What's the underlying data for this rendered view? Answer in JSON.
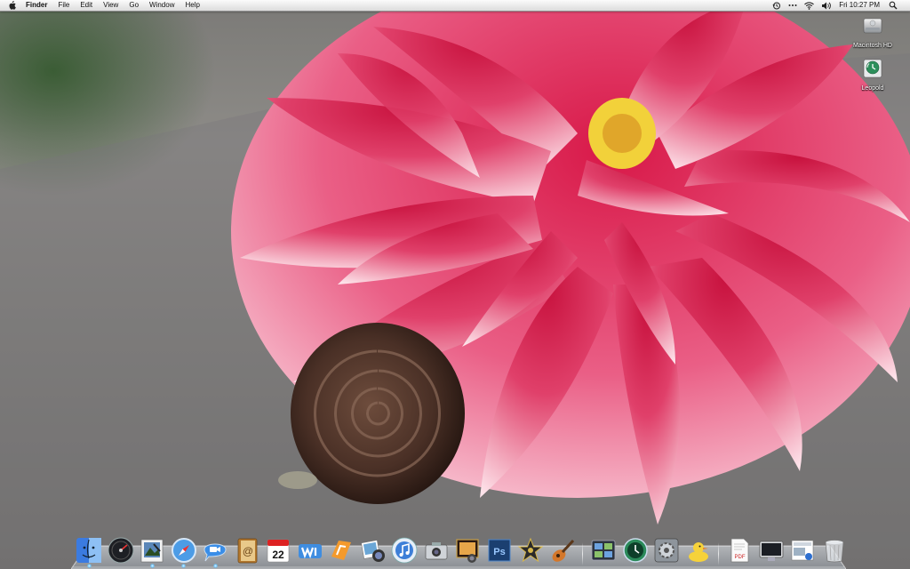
{
  "menubar": {
    "app_name": "Finder",
    "menus": [
      "File",
      "Edit",
      "View",
      "Go",
      "Window",
      "Help"
    ],
    "clock": "Fri 10:27 PM",
    "status_icons": [
      "time-machine-icon",
      "more-extras-icon",
      "wifi-icon",
      "volume-icon"
    ]
  },
  "desktop": {
    "icons": [
      {
        "label": "Macintosh HD",
        "icon": "hard-drive-icon"
      },
      {
        "label": "Leopold",
        "icon": "time-machine-disk-icon"
      }
    ]
  },
  "dock": {
    "apps": [
      {
        "name": "Finder",
        "icon": "finder-icon",
        "running": true
      },
      {
        "name": "Dashboard",
        "icon": "dashboard-icon",
        "running": false
      },
      {
        "name": "Preview",
        "icon": "preview-icon",
        "running": true
      },
      {
        "name": "Safari",
        "icon": "safari-icon",
        "running": true
      },
      {
        "name": "iChat",
        "icon": "ichat-icon",
        "running": true
      },
      {
        "name": "Address Book",
        "icon": "address-book-icon",
        "running": false
      },
      {
        "name": "iCal",
        "icon": "ical-icon",
        "running": false,
        "badge_text": "22"
      },
      {
        "name": "iWeb",
        "icon": "iweb-icon",
        "running": false
      },
      {
        "name": "Pages",
        "icon": "pages-icon",
        "running": false
      },
      {
        "name": "iPhoto",
        "icon": "iphoto-icon",
        "running": false
      },
      {
        "name": "iTunes",
        "icon": "itunes-icon",
        "running": false
      },
      {
        "name": "Image Capture",
        "icon": "image-capture-icon",
        "running": false
      },
      {
        "name": "Photo Booth",
        "icon": "photo-booth-icon",
        "running": false
      },
      {
        "name": "Photoshop",
        "icon": "photoshop-icon",
        "running": false,
        "badge_text": "Ps"
      },
      {
        "name": "iMovie",
        "icon": "imovie-icon",
        "running": false
      },
      {
        "name": "GarageBand",
        "icon": "garageband-icon",
        "running": false
      },
      {
        "name": "Spaces",
        "icon": "spaces-icon",
        "running": false
      },
      {
        "name": "Time Machine",
        "icon": "time-machine-icon",
        "running": false
      },
      {
        "name": "System Preferences",
        "icon": "system-preferences-icon",
        "running": false
      },
      {
        "name": "Cyberduck",
        "icon": "cyberduck-icon",
        "running": false
      }
    ],
    "stacks": [
      {
        "name": "Document",
        "icon": "pdf-document-icon",
        "badge_text": "PDF"
      },
      {
        "name": "Screen",
        "icon": "screen-icon"
      },
      {
        "name": "Downloads",
        "icon": "downloads-stack-icon"
      },
      {
        "name": "Trash",
        "icon": "trash-icon"
      }
    ]
  }
}
